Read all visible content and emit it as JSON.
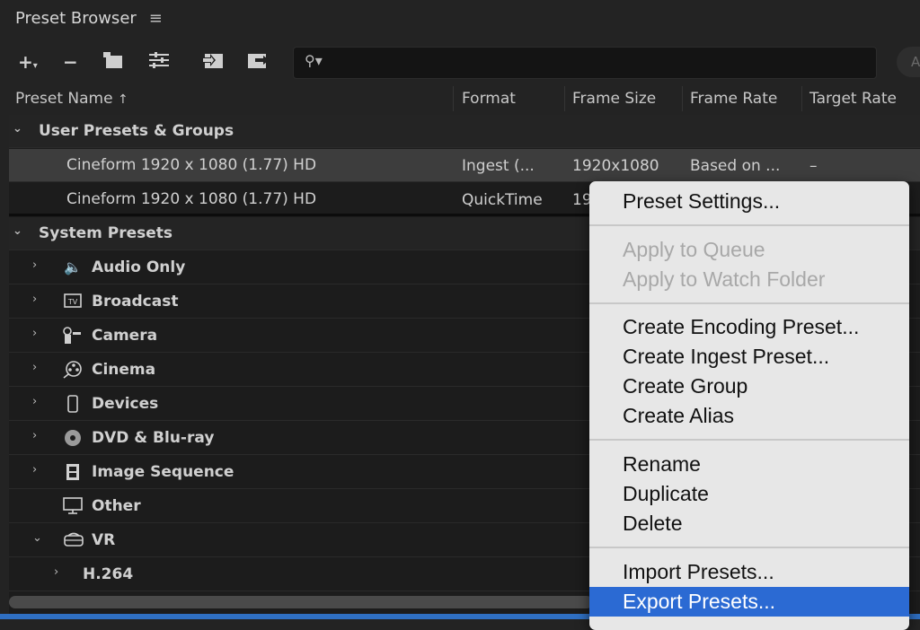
{
  "panel": {
    "title": "Preset Browser",
    "menu_icon": "hamburger-icon"
  },
  "toolbar": {
    "search_placeholder": "",
    "apply_label": "A"
  },
  "columns": [
    "Preset Name",
    "Format",
    "Frame Size",
    "Frame Rate",
    "Target Rate"
  ],
  "user_group": {
    "label": "User Presets & Groups",
    "rows": [
      {
        "name": "Cineform 1920 x 1080 (1.77) HD",
        "format": "Ingest (...",
        "frame_size": "1920x1080",
        "frame_rate": "Based on ...",
        "target_rate": "–"
      },
      {
        "name": "Cineform 1920 x 1080 (1.77) HD",
        "format": "QuickTime",
        "frame_size": "19",
        "frame_rate": "",
        "target_rate": ""
      }
    ]
  },
  "system_group": {
    "label": "System Presets",
    "categories": [
      {
        "label": "Audio Only",
        "icon": "speaker-icon"
      },
      {
        "label": "Broadcast",
        "icon": "tv-icon"
      },
      {
        "label": "Camera",
        "icon": "camera-icon"
      },
      {
        "label": "Cinema",
        "icon": "film-reel-icon"
      },
      {
        "label": "Devices",
        "icon": "phone-icon"
      },
      {
        "label": "DVD & Blu-ray",
        "icon": "disc-icon"
      },
      {
        "label": "Image Sequence",
        "icon": "filmstrip-icon"
      },
      {
        "label": "Other",
        "icon": "monitor-icon"
      },
      {
        "label": "VR",
        "icon": "vr-headset-icon"
      }
    ],
    "vr_child": "H.264"
  },
  "context_menu": {
    "preset_settings": "Preset Settings...",
    "apply_to_queue": "Apply to Queue",
    "apply_to_watch_folder": "Apply to Watch Folder",
    "create_encoding_preset": "Create Encoding Preset...",
    "create_ingest_preset": "Create Ingest Preset...",
    "create_group": "Create Group",
    "create_alias": "Create Alias",
    "rename": "Rename",
    "duplicate": "Duplicate",
    "delete": "Delete",
    "import_presets": "Import Presets...",
    "export_presets": "Export Presets..."
  },
  "colors": {
    "highlight": "#2b6ad3",
    "background": "#232323",
    "menu_bg": "#e7e7e7"
  }
}
